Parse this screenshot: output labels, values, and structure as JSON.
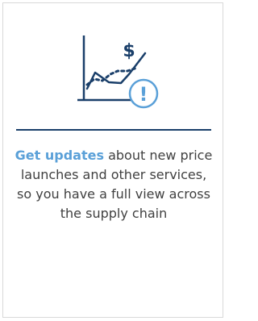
{
  "card": {
    "highlight": "Get updates",
    "body": " about new price launches and other services, so you have a full view across the supply chain"
  },
  "illustration": {
    "currency_symbol": "$",
    "alert_symbol": "!",
    "icon_name": "price-chart-alert-icon"
  },
  "colors": {
    "navy": "#1a3f6a",
    "accent_blue": "#5aa0d8",
    "body_text": "#404040",
    "card_border": "#d9d9d9"
  }
}
